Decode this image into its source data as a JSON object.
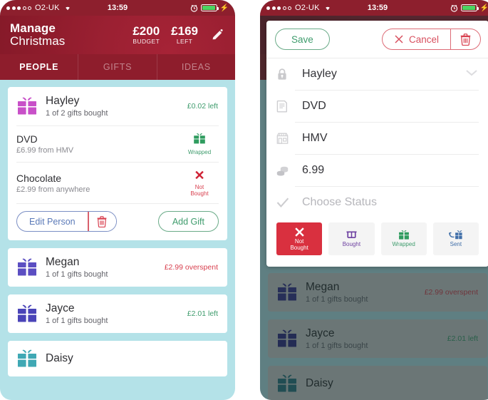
{
  "status_bar": {
    "carrier": "O2-UK",
    "signal_filled": 3,
    "signal_hollow": 2,
    "wifi_icon": "wifi-icon",
    "time": "13:59",
    "alarm_icon": "alarm-clock-icon",
    "battery_level": 96,
    "charging_icon": "lightning-bolt-icon",
    "battery_color": "#4cd461"
  },
  "header": {
    "title_line1": "Manage",
    "title_line2": "Christmas",
    "budget_amount": "£200",
    "budget_caption": "BUDGET",
    "left_amount": "£169",
    "left_caption": "LEFT",
    "edit_icon": "pencil-icon",
    "background_color": "#9b2032"
  },
  "tabs": [
    {
      "label": "PEOPLE",
      "active": true
    },
    {
      "label": "GIFTS",
      "active": false
    },
    {
      "label": "IDEAS",
      "active": false
    }
  ],
  "people": [
    {
      "name": "Hayley",
      "subtitle": "1 of 2 gifts bought",
      "amount": "£0.02 left",
      "amount_state": "ok",
      "gift_icon": "gift-box-icon",
      "gift_color": "#c850c8",
      "expanded": true,
      "gifts": [
        {
          "name": "DVD",
          "subtitle": "£6.99 from HMV",
          "status_label": "Wrapped",
          "status_icon": "gift-box-icon",
          "status_state": "wrapped"
        },
        {
          "name": "Chocolate",
          "subtitle": "£2.99 from anywhere",
          "status_label": "Not\nBought",
          "status_icon": "cross-icon",
          "status_state": "notbought"
        }
      ],
      "actions": {
        "edit_label": "Edit Person",
        "delete_icon": "trash-icon",
        "add_gift_label": "Add Gift"
      }
    },
    {
      "name": "Megan",
      "subtitle": "1 of 1 gifts bought",
      "amount": "£2.99 overspent",
      "amount_state": "over",
      "gift_icon": "gift-box-icon",
      "gift_color": "#5b4ec2",
      "expanded": false
    },
    {
      "name": "Jayce",
      "subtitle": "1 of 1 gifts bought",
      "amount": "£2.01 left",
      "amount_state": "ok",
      "gift_icon": "gift-box-icon",
      "gift_color": "#4a44b8",
      "expanded": false
    },
    {
      "name": "Daisy",
      "subtitle": "",
      "amount": "",
      "amount_state": "ok",
      "gift_icon": "gift-box-icon",
      "gift_color": "#3fa8b4",
      "expanded": false
    }
  ],
  "modal": {
    "save_label": "Save",
    "cancel_label": "Cancel",
    "cancel_icon": "close-x-icon",
    "delete_icon": "trash-icon",
    "fields": [
      {
        "icon": "lock-icon",
        "value": "Hayley",
        "placeholder": false,
        "chevron": true
      },
      {
        "icon": "note-icon",
        "value": "DVD",
        "placeholder": false,
        "chevron": false
      },
      {
        "icon": "shop-icon",
        "value": "HMV",
        "placeholder": false,
        "chevron": false
      },
      {
        "icon": "coins-icon",
        "value": "6.99",
        "placeholder": false,
        "chevron": false
      },
      {
        "icon": "checkmark-icon",
        "value": "Choose Status",
        "placeholder": true,
        "chevron": false
      }
    ],
    "status_options": [
      {
        "label_line1": "Not",
        "label_line2": "Bought",
        "icon": "cross-icon",
        "selected": true,
        "state": "sel"
      },
      {
        "label_line1": "Bought",
        "label_line2": "",
        "icon": "shopping-bag-icon",
        "selected": false,
        "state": "bought"
      },
      {
        "label_line1": "Wrapped",
        "label_line2": "",
        "icon": "gift-box-icon",
        "selected": false,
        "state": "wrapped"
      },
      {
        "label_line1": "Sent",
        "label_line2": "",
        "icon": "send-gift-icon",
        "selected": false,
        "state": "sent"
      }
    ],
    "selected_color": "#d9303f"
  },
  "colors": {
    "page_background": "#b4e2e8",
    "brand_red": "#9b2032",
    "green": "#3f9c6d",
    "red": "#d8404f",
    "blue": "#5b7ab8"
  }
}
